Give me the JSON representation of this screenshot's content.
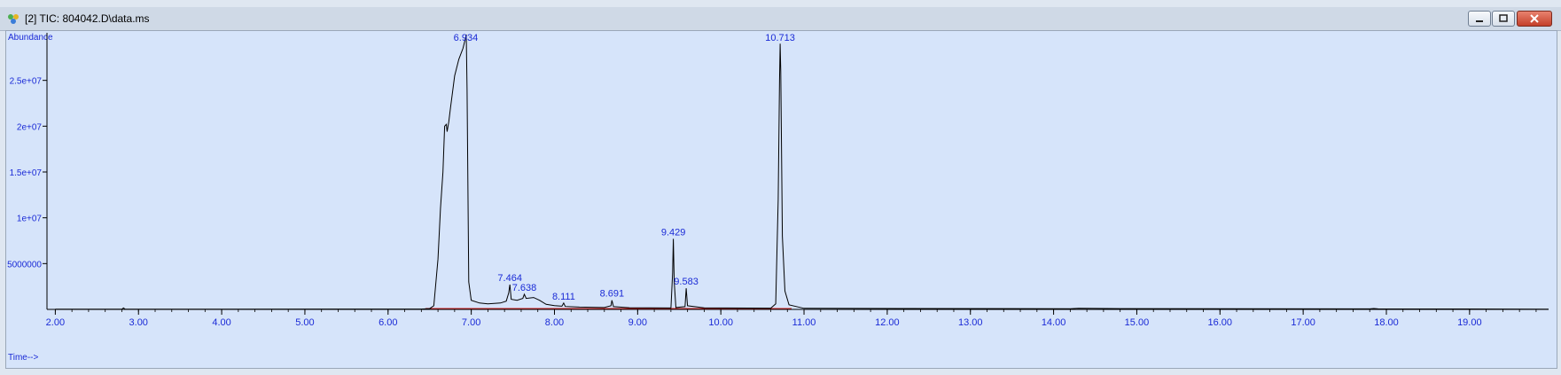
{
  "window": {
    "title": "[2] TIC: 804042.D\\data.ms",
    "title_icon": "chromatogram-icon",
    "controls": {
      "minimize": "minimize-icon",
      "restore": "restore-icon",
      "close": "close-icon"
    },
    "colors": {
      "close": "#c4402a",
      "panel": "#d6e4fa"
    }
  },
  "chart_data": {
    "type": "line",
    "xlabel": "Time-->",
    "ylabel": "Abundance",
    "xlim": [
      1.9,
      19.95
    ],
    "ylim": [
      0,
      30000000
    ],
    "x_ticks": [
      2.0,
      3.0,
      4.0,
      5.0,
      6.0,
      7.0,
      8.0,
      9.0,
      10.0,
      11.0,
      12.0,
      13.0,
      14.0,
      15.0,
      16.0,
      17.0,
      18.0,
      19.0
    ],
    "x_tick_labels": [
      "2.00",
      "3.00",
      "4.00",
      "5.00",
      "6.00",
      "7.00",
      "8.00",
      "9.00",
      "10.00",
      "11.00",
      "12.00",
      "13.00",
      "14.00",
      "15.00",
      "16.00",
      "17.00",
      "18.00",
      "19.00"
    ],
    "y_ticks": [
      5000000,
      10000000,
      15000000,
      20000000,
      25000000
    ],
    "y_tick_labels": [
      "5000000",
      "1e+07",
      "1.5e+07",
      "2e+07",
      "2.5e+07"
    ],
    "grid": false,
    "colors": {
      "trace": "#000000",
      "baseline": "#d02020",
      "labels": "#1a2ad6",
      "axis_text": "#1a2ad6"
    },
    "peak_labels": [
      {
        "x": 6.934,
        "y": 30000000,
        "label": "6.934"
      },
      {
        "x": 7.464,
        "y": 2700000,
        "label": "7.464"
      },
      {
        "x": 7.638,
        "y": 1650000,
        "label": "7.638"
      },
      {
        "x": 8.111,
        "y": 700000,
        "label": "8.111"
      },
      {
        "x": 8.691,
        "y": 1000000,
        "label": "8.691"
      },
      {
        "x": 9.429,
        "y": 7700000,
        "label": "9.429"
      },
      {
        "x": 9.583,
        "y": 2300000,
        "label": "9.583"
      },
      {
        "x": 10.713,
        "y": 29000000,
        "label": "10.713"
      }
    ],
    "series": [
      {
        "values": [
          [
            2.0,
            20000
          ],
          [
            2.8,
            20000
          ],
          [
            2.82,
            150000
          ],
          [
            2.84,
            20000
          ],
          [
            6.4,
            40000
          ],
          [
            6.5,
            90000
          ],
          [
            6.55,
            400000
          ],
          [
            6.6,
            5500000
          ],
          [
            6.63,
            11000000
          ],
          [
            6.66,
            15000000
          ],
          [
            6.68,
            20000000
          ],
          [
            6.7,
            20200000
          ],
          [
            6.71,
            19400000
          ],
          [
            6.73,
            20500000
          ],
          [
            6.75,
            22000000
          ],
          [
            6.8,
            25500000
          ],
          [
            6.85,
            27300000
          ],
          [
            6.9,
            28500000
          ],
          [
            6.93,
            29600000
          ],
          [
            6.94,
            30000000
          ],
          [
            6.95,
            24000000
          ],
          [
            6.97,
            3000000
          ],
          [
            7.0,
            1000000
          ],
          [
            7.1,
            700000
          ],
          [
            7.2,
            600000
          ],
          [
            7.35,
            700000
          ],
          [
            7.42,
            900000
          ],
          [
            7.45,
            1800000
          ],
          [
            7.464,
            2700000
          ],
          [
            7.48,
            1100000
          ],
          [
            7.55,
            1000000
          ],
          [
            7.62,
            1200000
          ],
          [
            7.638,
            1650000
          ],
          [
            7.66,
            1200000
          ],
          [
            7.75,
            1300000
          ],
          [
            7.82,
            1000000
          ],
          [
            7.9,
            550000
          ],
          [
            8.0,
            420000
          ],
          [
            8.09,
            350000
          ],
          [
            8.111,
            700000
          ],
          [
            8.13,
            320000
          ],
          [
            8.3,
            250000
          ],
          [
            8.6,
            200000
          ],
          [
            8.68,
            400000
          ],
          [
            8.691,
            1000000
          ],
          [
            8.71,
            300000
          ],
          [
            8.9,
            180000
          ],
          [
            9.4,
            150000
          ],
          [
            9.42,
            4000000
          ],
          [
            9.429,
            7700000
          ],
          [
            9.44,
            3000000
          ],
          [
            9.46,
            200000
          ],
          [
            9.57,
            300000
          ],
          [
            9.583,
            2300000
          ],
          [
            9.6,
            400000
          ],
          [
            9.8,
            160000
          ],
          [
            10.6,
            140000
          ],
          [
            10.66,
            600000
          ],
          [
            10.69,
            12000000
          ],
          [
            10.705,
            25000000
          ],
          [
            10.713,
            29000000
          ],
          [
            10.72,
            26000000
          ],
          [
            10.74,
            8000000
          ],
          [
            10.77,
            2000000
          ],
          [
            10.82,
            500000
          ],
          [
            11.0,
            120000
          ],
          [
            14.2,
            80000
          ],
          [
            14.3,
            130000
          ],
          [
            14.8,
            90000
          ],
          [
            17.8,
            60000
          ],
          [
            17.85,
            100000
          ],
          [
            17.9,
            60000
          ],
          [
            19.95,
            30000
          ]
        ]
      }
    ]
  }
}
